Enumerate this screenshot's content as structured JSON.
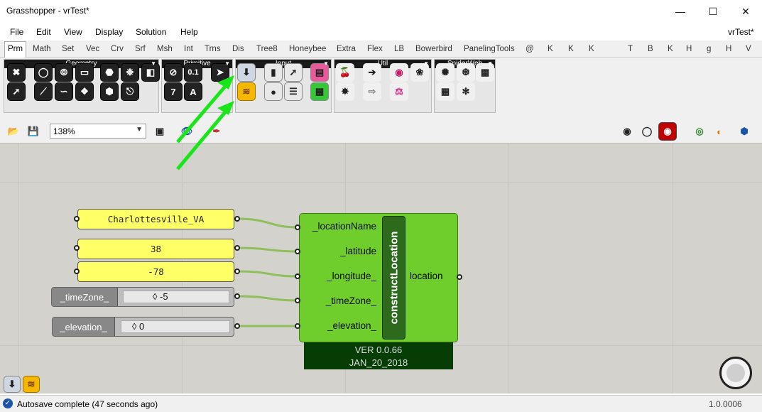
{
  "window": {
    "title": "Grasshopper - vrTest*",
    "doc_label": "vrTest*"
  },
  "menu": [
    "File",
    "Edit",
    "View",
    "Display",
    "Solution",
    "Help"
  ],
  "tabs": [
    "Prm",
    "Math",
    "Set",
    "Vec",
    "Crv",
    "Srf",
    "Msh",
    "Int",
    "Trns",
    "Dis",
    "Tree8",
    "Honeybee",
    "Extra",
    "Flex",
    "LB",
    "Bowerbird",
    "PanelingTools",
    "@",
    "K",
    "K",
    "K",
    "T",
    "B",
    "K",
    "H",
    "g",
    "H",
    "V"
  ],
  "ribbon": {
    "geometry_label": "Geometry",
    "primitive_label": "Primitive",
    "input_label": "Input",
    "util_label": "Util",
    "spiderweb_label": "SpiderWeb",
    "primitive_icon_text": [
      "0.1",
      "7",
      "A"
    ]
  },
  "toolbar": {
    "zoom": "138%"
  },
  "canvas": {
    "panels": [
      "Charlottesville_VA",
      "38",
      "-78"
    ],
    "sliders": [
      {
        "label": "_timeZone_",
        "value": "◊ -5"
      },
      {
        "label": "_elevation_",
        "value": "◊ 0"
      }
    ],
    "component": {
      "name": "constructLocation",
      "inputs": [
        "_locationName",
        "_latitude",
        "_longitude_",
        "_timeZone_",
        "_elevation_"
      ],
      "output": "location",
      "version": "VER 0.0.66",
      "date": "JAN_20_2018"
    },
    "arrow_color": "#19e619",
    "wire_color": "#8fbf5a"
  },
  "status": {
    "message": "Autosave complete (47 seconds ago)",
    "version": "1.0.0006"
  }
}
